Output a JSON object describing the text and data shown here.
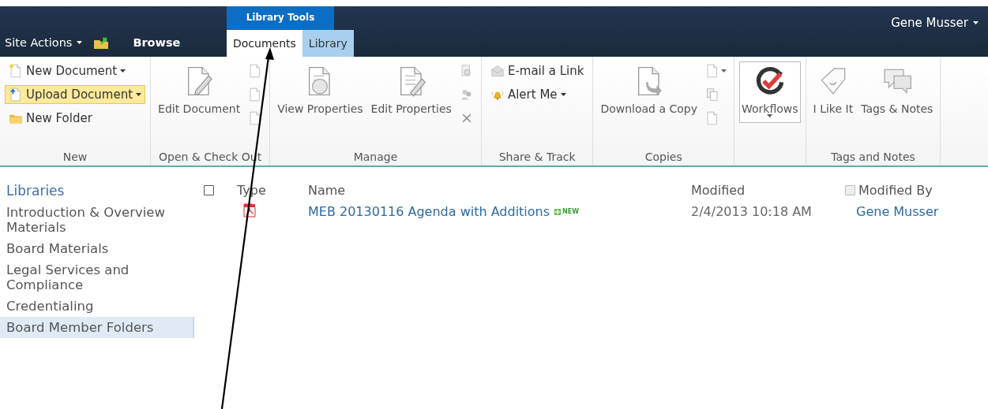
{
  "top_bar": {
    "site_actions": "Site Actions",
    "browse_tab": "Browse",
    "context_group": "Library Tools",
    "tabs": [
      {
        "label": "Documents",
        "selected": true
      },
      {
        "label": "Library",
        "selected": false
      }
    ],
    "user": "Gene Musser"
  },
  "ribbon": {
    "groups": [
      {
        "label": "New",
        "items": [
          {
            "kind": "small",
            "label": "New Document",
            "dropdown": true,
            "highlighted": false
          },
          {
            "kind": "small",
            "label": "Upload Document",
            "dropdown": true,
            "highlighted": true
          },
          {
            "kind": "small",
            "label": "New Folder",
            "dropdown": false,
            "highlighted": false
          }
        ]
      },
      {
        "label": "Open & Check Out",
        "items": [
          {
            "kind": "large",
            "label": "Edit Document",
            "dropdown": false,
            "highlighted": false
          },
          {
            "kind": "icon",
            "dropdown": false,
            "highlighted": false
          },
          {
            "kind": "icon",
            "dropdown": false,
            "highlighted": false
          },
          {
            "kind": "icon",
            "dropdown": false,
            "highlighted": false
          }
        ]
      },
      {
        "label": "Manage",
        "items": [
          {
            "kind": "large",
            "label": "View Properties",
            "dropdown": false,
            "highlighted": false
          },
          {
            "kind": "large",
            "label": "Edit Properties",
            "dropdown": false,
            "highlighted": false
          },
          {
            "kind": "icon",
            "dropdown": false,
            "highlighted": false
          },
          {
            "kind": "icon",
            "dropdown": false,
            "highlighted": false
          },
          {
            "kind": "icon",
            "dropdown": false,
            "highlighted": false
          }
        ]
      },
      {
        "label": "Share & Track",
        "items": [
          {
            "kind": "small",
            "label": "E-mail a Link",
            "dropdown": false,
            "highlighted": false
          },
          {
            "kind": "small",
            "label": "Alert Me",
            "dropdown": true,
            "highlighted": false
          }
        ]
      },
      {
        "label": "Copies",
        "items": [
          {
            "kind": "large",
            "label": "Download a Copy",
            "dropdown": false,
            "highlighted": false
          },
          {
            "kind": "icon",
            "dropdown": true,
            "highlighted": false
          },
          {
            "kind": "icon",
            "dropdown": false,
            "highlighted": false
          },
          {
            "kind": "icon",
            "dropdown": false,
            "highlighted": false
          }
        ]
      },
      {
        "items": [
          {
            "kind": "large",
            "label": "Workflows",
            "dropdown": true,
            "highlighted": true
          }
        ]
      },
      {
        "label": "Tags and Notes",
        "items": [
          {
            "kind": "large",
            "label": "I Like It",
            "dropdown": false,
            "highlighted": false
          },
          {
            "kind": "large",
            "label": "Tags & Notes",
            "dropdown": false,
            "highlighted": false
          }
        ]
      }
    ]
  },
  "sidebar": {
    "title": "Libraries",
    "items": [
      {
        "label": "Introduction & Overview Materials",
        "selected": false
      },
      {
        "label": "Board Materials",
        "selected": false
      },
      {
        "label": "Legal Services and Compliance",
        "selected": false
      },
      {
        "label": "Credentialing",
        "selected": false
      },
      {
        "label": "Board Member Folders",
        "selected": true
      }
    ]
  },
  "table": {
    "select_all_checked": false,
    "modified_by_checked": false,
    "columns": [
      "Type",
      "Name",
      "Modified",
      "Modified By"
    ],
    "rows": [
      {
        "name": "MEB 20130116 Agenda with Additions",
        "badge": "NEW",
        "modified": "2/4/2013 10:18 AM",
        "modified_by": "Gene Musser"
      }
    ]
  }
}
